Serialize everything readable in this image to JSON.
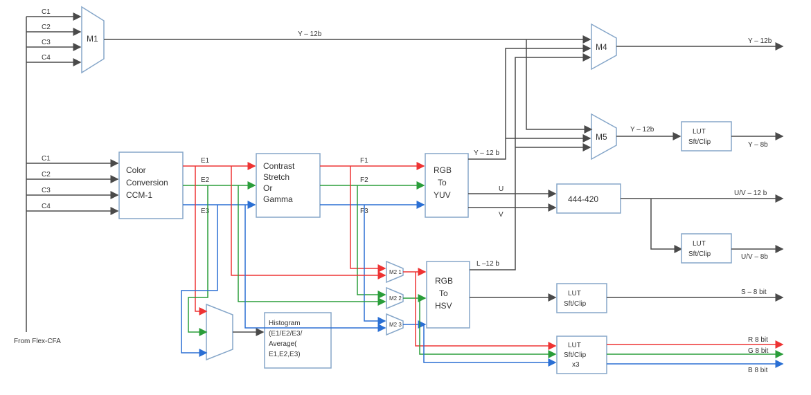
{
  "inputs_top": [
    "C1",
    "C2",
    "C3",
    "C4"
  ],
  "inputs_mid": [
    "C1",
    "C2",
    "C3",
    "C4"
  ],
  "from_label": "From Flex-CFA",
  "mux": {
    "m1": "M1",
    "m2_1": "M2 1",
    "m2_2": "M2 2",
    "m2_3": "M2 3",
    "hist_mux": "",
    "m4": "M4",
    "m5": "M5"
  },
  "blocks": {
    "ccm": "Color Conversion CCM-1",
    "contrast": "Contrast Stretch Or Gamma",
    "rgb_yuv": "RGB To YUV",
    "rgb_hsv": "RGB To HSV",
    "hist": "Histogram (E1/E2/E3/ Average( E1,E2,E3)",
    "c444_420": "444-420",
    "lut_y": "LUT Sft/Clip",
    "lut_uv": "LUT Sft/Clip",
    "lut_s": "LUT Sft/Clip",
    "lut_rgb": "LUT Sft/Clip x3"
  },
  "signals": {
    "E1": "E1",
    "E2": "E2",
    "E3": "E3",
    "F1": "F1",
    "F2": "F2",
    "F3": "F3",
    "Y12b_top": "Y – 12b",
    "Y12b_yuv": "Y – 12 b",
    "U": "U",
    "V": "V",
    "L12b": "L –12 b",
    "Y12b_m4": "Y – 12b",
    "Y12b_m5": "Y – 12b",
    "out_y12": "Y – 12b",
    "out_y8": "Y – 8b",
    "out_uv12": "U/V – 12 b",
    "out_uv8": "U/V – 8b",
    "out_s8": "S – 8 bit",
    "out_r8": "R 8 bit",
    "out_g8": "G 8 bit",
    "out_b8": "B 8 bit"
  }
}
